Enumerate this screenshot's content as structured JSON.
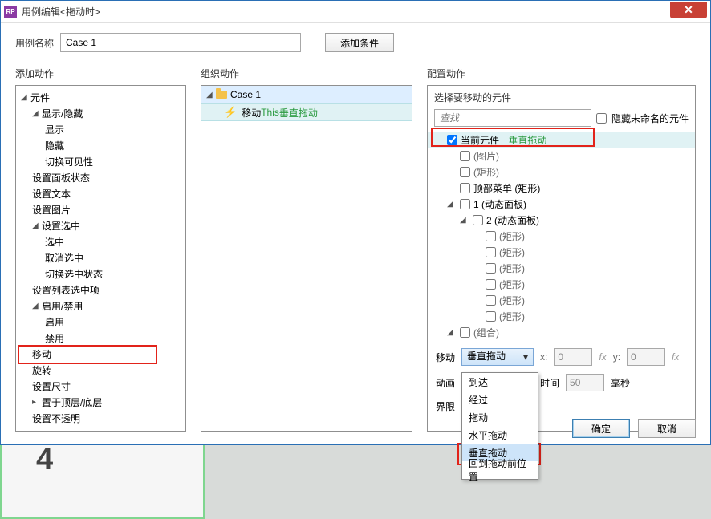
{
  "window": {
    "title": "用例编辑<拖动时>"
  },
  "top": {
    "case_label": "用例名称",
    "case_value": "Case 1",
    "add_condition": "添加条件"
  },
  "panel_labels": {
    "p1": "添加动作",
    "p2": "组织动作",
    "p3": "配置动作"
  },
  "actions_tree": {
    "root": "元件",
    "show_hide": "显示/隐藏",
    "show": "显示",
    "hide": "隐藏",
    "toggle_vis": "切换可见性",
    "set_panel_state": "设置面板状态",
    "set_text": "设置文本",
    "set_image": "设置图片",
    "set_selected": "设置选中",
    "select": "选中",
    "deselect": "取消选中",
    "toggle_sel": "切换选中状态",
    "set_list_sel": "设置列表选中项",
    "enable_disable": "启用/禁用",
    "enable": "启用",
    "disable": "禁用",
    "move": "移动",
    "rotate": "旋转",
    "set_size": "设置尺寸",
    "bring_front_back": "置于顶层/底层",
    "set_opacity": "设置不透明"
  },
  "organize": {
    "case_label": "Case 1",
    "move_prefix": "移动 ",
    "move_this": "This ",
    "move_suffix": "垂直拖动"
  },
  "config": {
    "header": "选择要移动的元件",
    "search_placeholder": "查找",
    "hide_unnamed": "隐藏未命名的元件",
    "current": "当前元件",
    "current_suffix": "垂直拖动",
    "items": {
      "image": "(图片)",
      "rect1": "(矩形)",
      "top_menu": "顶部菜单 (矩形)",
      "dp1": "1 (动态面板)",
      "dp2": "2 (动态面板)",
      "r1": "(矩形)",
      "r2": "(矩形)",
      "r3": "(矩形)",
      "r4": "(矩形)",
      "r5": "(矩形)",
      "r6": "(矩形)",
      "group": "(组合)"
    },
    "move_label": "移动",
    "move_value": "垂直拖动",
    "x_label": "x:",
    "x_value": "0",
    "y_label": "y:",
    "y_value": "0",
    "anim_label": "动画",
    "time_label": "时间",
    "time_value": "50",
    "ms": "毫秒",
    "bounds_label": "界限"
  },
  "dropdown": {
    "opt1": "到达",
    "opt2": "经过",
    "opt3": "拖动",
    "opt4": "水平拖动",
    "opt5": "垂直拖动",
    "opt6": "回到拖动前位置"
  },
  "footer": {
    "ok": "确定",
    "cancel": "取消"
  },
  "bg_number": "4"
}
